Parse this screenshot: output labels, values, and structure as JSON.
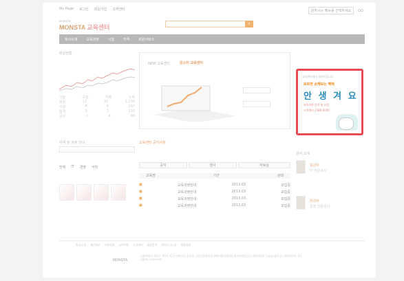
{
  "header": {
    "links": [
      "My Page",
      "로그인",
      "회원가입",
      "고객센터"
    ],
    "right": {
      "select_label": "원하시는 메뉴를 선택하세요",
      "go_label": "GO"
    }
  },
  "brand": {
    "logo_top": "MONSTA",
    "logo_main": "MONSTA",
    "logo_sub": "교육센터"
  },
  "search": {
    "placeholder": ""
  },
  "nav": {
    "items": [
      "회사소개",
      "교육과정",
      "시험",
      "자격",
      "회원서비스"
    ]
  },
  "left": {
    "section_title": "회원현황",
    "stats_rows": [
      [
        "구분",
        "오늘",
        "어제",
        "누적"
      ],
      [
        "회원",
        "12",
        "10",
        "1,234"
      ],
      [
        "수강",
        "8",
        "6",
        "567"
      ],
      [
        "합격",
        "3",
        "2",
        "210"
      ],
      [
        "문의",
        "1",
        "4",
        "98"
      ]
    ],
    "bottom_title": "자격 및 과정 안내",
    "tabs": [
      "전체",
      "IT",
      "경영",
      "어학"
    ]
  },
  "center": {
    "banner_title": "NEW 교육센터",
    "banner_orange": "몬스타 교육센터",
    "news_title": "교육센터 공지사항",
    "tabs": [
      "공지",
      "행사",
      "자료실"
    ],
    "table_header": [
      "",
      "교육명",
      "기간",
      "상태"
    ],
    "rows": [
      [
        "교육과정안내",
        "2013.03",
        "모집중"
      ],
      [
        "교육과정안내",
        "2013.03",
        "모집중"
      ],
      [
        "교육과정안내",
        "2013.03",
        "모집중"
      ],
      [
        "교육과정안내",
        "2013.03",
        "모집중"
      ]
    ]
  },
  "ad": {
    "head": "교육센터에서 알려드립니다",
    "orange": "모르면 손해보는 혜택",
    "big": "안 생 겨 요",
    "line1": "교육과정 문의 및 신청",
    "line2": "고객센터 1588-0000"
  },
  "right_column": {
    "title": "강사 소개",
    "people": [
      {
        "name": "김강사",
        "desc": "IT 전문강사"
      },
      {
        "name": "이강사",
        "desc": "경영 전문강사"
      }
    ]
  },
  "footer": {
    "links": [
      "회사소개",
      "개인정보",
      "이용약관",
      "사이트맵",
      "고객센터",
      "제휴문의",
      "찾아오시는길",
      "채용정보"
    ],
    "logo": "MONSTA",
    "text": "서울특별시 OO구 OO로 123 대표이사 홍길동 사업자등록번호 000-00-00000 통신판매업신고 제0000호 Copyright (c) MONSTA. All rights reserved."
  }
}
